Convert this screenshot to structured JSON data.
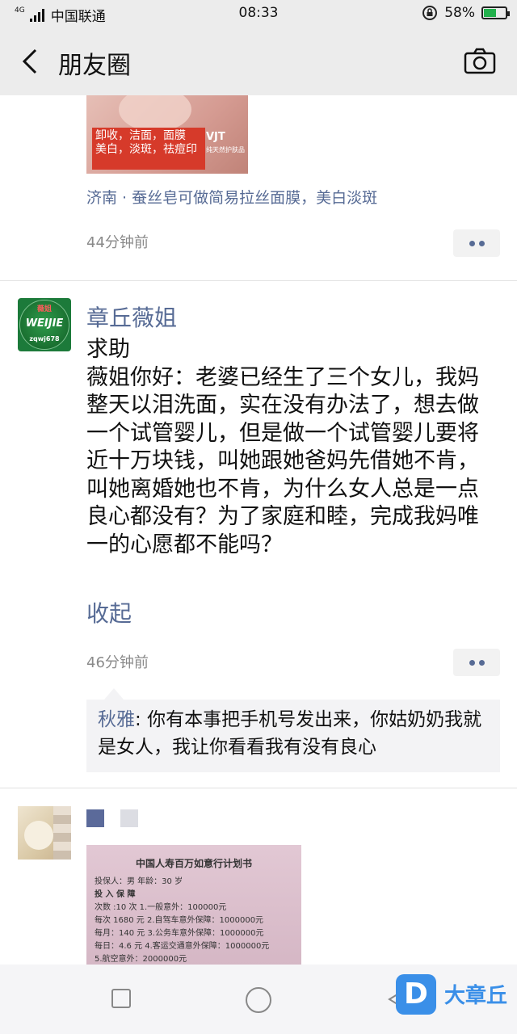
{
  "status_bar": {
    "network": "4G",
    "carrier": "中国联通",
    "time": "08:33",
    "battery_percent": "58%",
    "battery_level": 0.58
  },
  "nav": {
    "title": "朋友圈",
    "back_icon": "back-arrow-icon",
    "camera_icon": "camera-icon"
  },
  "post1": {
    "image_text_line1": "卸收，洁面，面膜",
    "image_text_line2": "美白，淡斑，祛痘印",
    "brand": "VJT",
    "brand_sub": "纯天然护肤品",
    "location": "济南 · 蚕丝皂可做简易拉丝面膜，美白淡斑",
    "time": "44分钟前"
  },
  "post2": {
    "avatar_text_top": "薇姐",
    "avatar_text_main": "WEIJIE",
    "avatar_text_bottom": "zqwj678",
    "username": "章丘薇姐",
    "heading": "求助",
    "body": "薇姐你好：老婆已经生了三个女儿，我妈整天以泪洗面，实在没有办法了，想去做一个试管婴儿，但是做一个试管婴儿要将近十万块钱，叫她跟她爸妈先借她不肯，叫她离婚她也不肯，为什么女人总是一点良心都没有？为了家庭和睦，完成我妈唯一的心愿都不能吗？",
    "collapse_label": "收起",
    "time": "46分钟前",
    "comments": [
      {
        "author": "秋雅",
        "separator": ": ",
        "text": "你有本事把手机号发出来，你姑奶奶我就是女人，我让你看看我有没有良心"
      }
    ]
  },
  "post3": {
    "doc_title": "中国人寿百万如意行计划书",
    "doc_lines": [
      "投保人：男        年龄：30 岁",
      "投  入              保        障",
      "次数 :10 次   1.一般意外：100000元",
      "每次 1680 元  2.自驾车意外保障：1000000元",
      "每月：140 元  3.公务车意外保障：1000000元",
      "每日：4.6 元  4.客运交通意外保障：1000000元",
      "                     5.航空意外：2000000元"
    ]
  },
  "system_nav": {
    "recents_icon": "square-icon",
    "home_icon": "circle-icon",
    "back_icon": "triangle-back-icon"
  },
  "watermark": {
    "logo_letter": "D",
    "text": "大章丘"
  }
}
